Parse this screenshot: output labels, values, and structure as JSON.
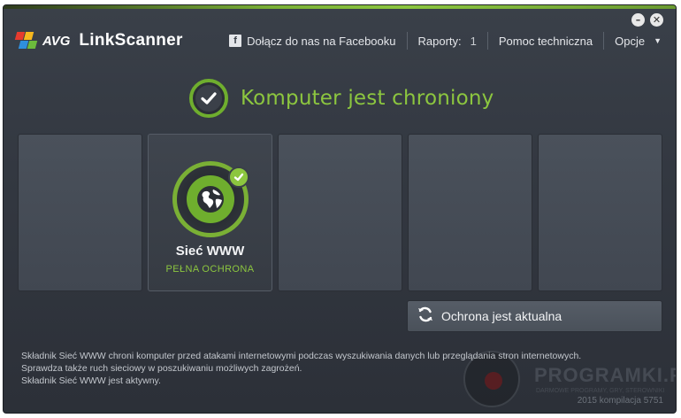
{
  "header": {
    "brand": "AVG",
    "product": "LinkScanner",
    "facebook_label": "Dołącz do nas na Facebooku",
    "reports_label": "Raporty:",
    "reports_count": "1",
    "support_label": "Pomoc techniczna",
    "options_label": "Opcje",
    "minimize_glyph": "–",
    "close_glyph": "✕"
  },
  "status": {
    "text": "Komputer jest chroniony"
  },
  "tiles": [
    {
      "title": "",
      "subtitle": ""
    },
    {
      "title": "Sieć WWW",
      "subtitle": "PEŁNA OCHRONA"
    },
    {
      "title": "",
      "subtitle": ""
    },
    {
      "title": "",
      "subtitle": ""
    },
    {
      "title": "",
      "subtitle": ""
    }
  ],
  "update_button": {
    "label": "Ochrona jest aktualna"
  },
  "description": {
    "line1": "Składnik Sieć WWW chroni komputer przed atakami internetowymi podczas wyszukiwania danych lub przeglądania stron internetowych.",
    "line2": "Sprawdza także ruch sieciowy w poszukiwaniu możliwych zagrożeń.",
    "line3": "Składnik Sieć WWW jest aktywny."
  },
  "watermark": {
    "text": "PROGRAMKI.PL",
    "subtext": "DARMOWE PROGRAMY, GRY, STEROWNIKI"
  },
  "build": "2015  kompilacja 5751",
  "colors": {
    "accent_green": "#8cc63f",
    "dark_green": "#6fae2e",
    "background": "#333841"
  }
}
